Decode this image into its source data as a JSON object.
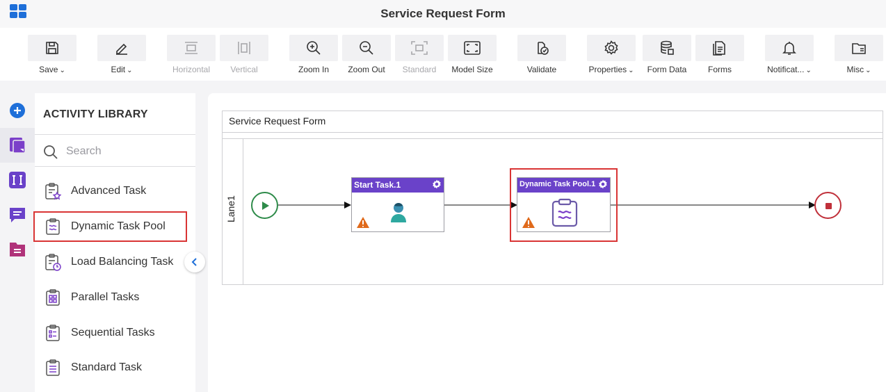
{
  "app": {
    "title": "Service Request Form"
  },
  "toolbar": {
    "buttons": [
      {
        "label": "Save",
        "icon": "save-icon",
        "dropdown": true,
        "enabled": true
      },
      {
        "label": "Edit",
        "icon": "edit-icon",
        "dropdown": true,
        "enabled": true
      },
      {
        "label": "Horizontal",
        "icon": "horizontal-icon",
        "dropdown": false,
        "enabled": false
      },
      {
        "label": "Vertical",
        "icon": "vertical-icon",
        "dropdown": false,
        "enabled": false
      },
      {
        "label": "Zoom In",
        "icon": "zoom-in-icon",
        "dropdown": false,
        "enabled": true
      },
      {
        "label": "Zoom Out",
        "icon": "zoom-out-icon",
        "dropdown": false,
        "enabled": true
      },
      {
        "label": "Standard",
        "icon": "standard-icon",
        "dropdown": false,
        "enabled": false
      },
      {
        "label": "Model Size",
        "icon": "model-size-icon",
        "dropdown": false,
        "enabled": true
      },
      {
        "label": "Validate",
        "icon": "validate-icon",
        "dropdown": false,
        "enabled": true
      },
      {
        "label": "Properties",
        "icon": "properties-icon",
        "dropdown": true,
        "enabled": true
      },
      {
        "label": "Form Data",
        "icon": "form-data-icon",
        "dropdown": false,
        "enabled": true
      },
      {
        "label": "Forms",
        "icon": "forms-icon",
        "dropdown": false,
        "enabled": true
      },
      {
        "label": "Notificat...",
        "icon": "notifications-icon",
        "dropdown": true,
        "enabled": true
      },
      {
        "label": "Misc",
        "icon": "misc-icon",
        "dropdown": true,
        "enabled": true
      }
    ]
  },
  "left_rail": {
    "items": [
      {
        "icon": "add-icon"
      },
      {
        "icon": "activity-library-icon",
        "active": true
      },
      {
        "icon": "variables-icon"
      },
      {
        "icon": "comments-icon"
      },
      {
        "icon": "documents-icon"
      }
    ]
  },
  "library": {
    "title": "ACTIVITY LIBRARY",
    "search_placeholder": "Search",
    "items": [
      {
        "label": "Advanced Task",
        "icon": "advanced-task-icon"
      },
      {
        "label": "Dynamic Task Pool",
        "icon": "dynamic-task-pool-icon",
        "selected": true
      },
      {
        "label": "Load Balancing Task",
        "icon": "load-balancing-task-icon"
      },
      {
        "label": "Parallel Tasks",
        "icon": "parallel-tasks-icon"
      },
      {
        "label": "Sequential Tasks",
        "icon": "sequential-tasks-icon"
      },
      {
        "label": "Standard Task",
        "icon": "standard-task-icon"
      }
    ]
  },
  "canvas": {
    "pool_title": "Service Request Form",
    "lane_label": "Lane1",
    "tasks": [
      {
        "label": "Start Task.1",
        "icon": "user-icon",
        "warning": true
      },
      {
        "label": "Dynamic Task Pool.1",
        "icon": "dynamic-task-pool-icon",
        "warning": true,
        "highlighted": true
      }
    ]
  },
  "colors": {
    "accent": "#1e6fd9",
    "task_header": "#6a42c9",
    "highlight": "#d93434",
    "start_event": "#2e8b4a",
    "end_event": "#c0303a",
    "warning": "#e06a1b"
  }
}
